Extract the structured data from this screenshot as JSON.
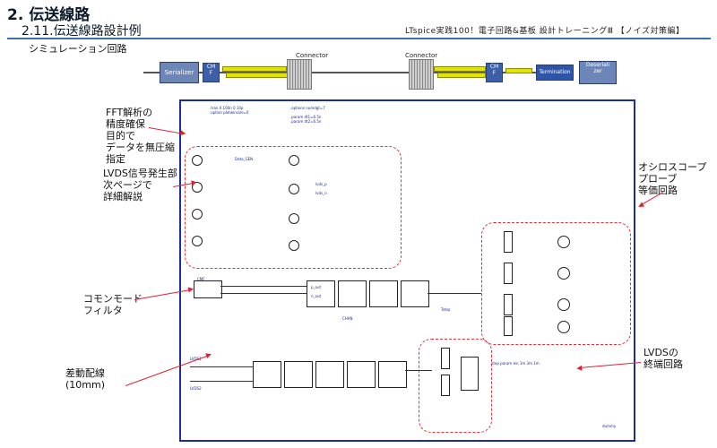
{
  "header": {
    "title": "2. 伝送線路",
    "subtitle": "2.11.伝送線路設計例",
    "right_text": "LTspice実践100！電子回路&基板 設計トレーニングⅢ 【ノイズ対策編】",
    "section": "シミュレーション回路"
  },
  "block_diagram": {
    "serializer": "Serializer",
    "cmf_left": "CM\nF",
    "connector_left": "Connector",
    "connector_right": "Connector",
    "cmf_right": "CM\nF",
    "termination": "Termination",
    "deserializer": "Deseriali\nzer"
  },
  "annotations": {
    "fft_note": "FFT解析の\n精度確保\n目的で\nデータを無圧縮\n指定",
    "lvds_gen_note": "LVDS信号発生部\n次ページで\n詳細解説",
    "cm_filter": "コモンモード\nフィルタ",
    "diff_trace": "差動配線\n(10mm)",
    "oscope_probe": "オシロスコープ\nプローブ\n等価回路",
    "lvds_term": "LVDSの\n終端回路"
  },
  "schematic": {
    "spice_top": [
      ".tran 0 100n 0 10p",
      ".option plotwinsize=0",
      ".options numdgt=7",
      ".param dt1=6.5n",
      ".param dt2=6.5n",
      ".step param len 1m 3m 1m"
    ],
    "labels": [
      "dummy",
      "CMF",
      "LVDS1",
      "LVDS2",
      "Tstep",
      "Data_GEN",
      "CHAN",
      "p_out",
      "n_out",
      "lvds_p",
      "lvds_n"
    ]
  }
}
